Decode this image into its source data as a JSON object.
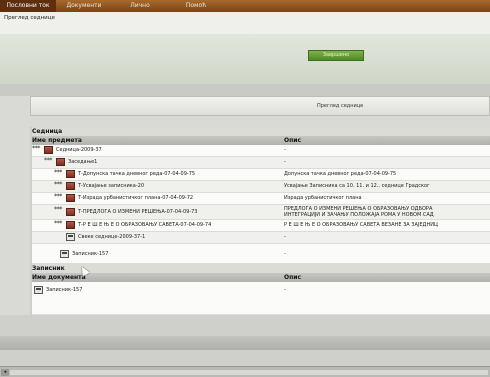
{
  "nav": {
    "tabs": [
      "Пословни ток",
      "Документи",
      "Лично",
      "Помоћ"
    ],
    "active_index": 0
  },
  "page": {
    "subtitle": "Преглед седнице",
    "green_button": "Завршено",
    "preview_label": "Преглед седнице"
  },
  "session": {
    "section_title": "Седница",
    "col_name": "Име предмета",
    "col_desc": "Опис",
    "rows": [
      {
        "stars": "***",
        "icon": "folder-icon",
        "name": "Седница-2009-37",
        "desc": "-"
      },
      {
        "stars": "***",
        "icon": "folder-icon",
        "name": "Заседање1",
        "desc": "-"
      },
      {
        "stars": "***",
        "icon": "folder-icon",
        "name": "Т-Допунска тачка дневног реда-07-04-09-75",
        "desc": "Допунска тачка дневног реда-07-04-09-75"
      },
      {
        "stars": "***",
        "icon": "folder-icon",
        "name": "Т-Усвајање записника-20",
        "desc": "Усвајање Записника са 10. 11. и 12.. седнице Градског"
      },
      {
        "stars": "***",
        "icon": "folder-icon",
        "name": "Т-Израда урбанистичког плана-07-04-09-72",
        "desc": "Израда урбанистичког плана"
      },
      {
        "stars": "***",
        "icon": "folder-icon",
        "name": "Т-ПРЕДЛОГА О ИЗМЕНИ РЕШЕЊА-07-04-09-73",
        "desc": "ПРЕДЛОГА О ИЗМЕНИ РЕШЕЊА О ОБРАЗОВАЊУ ОДБОРА",
        "desc2": "ИНТЕГРАЦИЈИ И ЗАЧАЊУ ПОЛОЖАЈА РОМА У НОВОМ САД"
      },
      {
        "stars": "***",
        "icon": "folder-icon",
        "name": "Т-Р Е Ш Е Њ Е О ОБРАЗОВАЊУ САВЕТА-07-04-09-74",
        "desc": "Р Е Ш Е Њ Е О ОБРАЗОВАЊУ САВЕТА ВЕЗАНЕ ЗА ЗАЈЕДНИЦ"
      },
      {
        "stars": "",
        "icon": "document-icon",
        "name": "Свеке седнице-2009-37-1",
        "desc": "-"
      },
      {
        "stars": "",
        "icon": "document-icon",
        "name": "Записник-157",
        "desc": "-"
      }
    ]
  },
  "minutes": {
    "section_title": "Записник",
    "col_name": "Име документа",
    "col_desc": "Опис",
    "rows": [
      {
        "icon": "document-icon",
        "name": "Записник-157",
        "desc": "-"
      }
    ]
  },
  "scrollbar": {
    "left_arrow": "◂"
  }
}
